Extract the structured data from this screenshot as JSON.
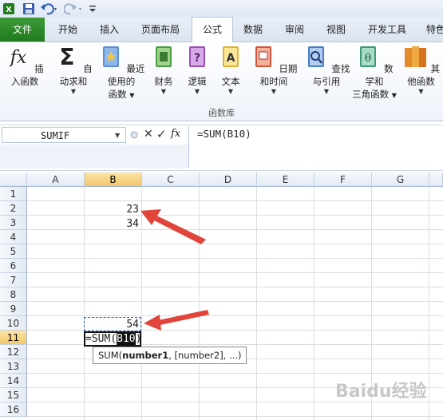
{
  "quick_access": {
    "icons": [
      "excel-icon",
      "save-icon",
      "undo-icon",
      "redo-icon",
      "customize-icon"
    ]
  },
  "tabs": {
    "file": "文件",
    "items": [
      "开始",
      "插入",
      "页面布局",
      "公式",
      "数据",
      "审阅",
      "视图",
      "开发工具",
      "特色"
    ],
    "active": "公式"
  },
  "ribbon": {
    "buttons": [
      {
        "label": "插入函数",
        "label2": "",
        "dropdown": false,
        "icon": "fx-icon"
      },
      {
        "label": "自动求和",
        "label2": "",
        "dropdown": true,
        "icon": "sigma-icon"
      },
      {
        "label": "最近使用的",
        "label2": "函数",
        "dropdown": true,
        "icon": "star-book-icon"
      },
      {
        "label": "财务",
        "label2": "",
        "dropdown": true,
        "icon": "finance-book-icon"
      },
      {
        "label": "逻辑",
        "label2": "",
        "dropdown": true,
        "icon": "logic-book-icon"
      },
      {
        "label": "文本",
        "label2": "",
        "dropdown": true,
        "icon": "text-book-icon"
      },
      {
        "label": "日期和时间",
        "label2": "",
        "dropdown": true,
        "icon": "datetime-book-icon"
      },
      {
        "label": "查找与引用",
        "label2": "",
        "dropdown": true,
        "icon": "lookup-book-icon"
      },
      {
        "label": "数学和",
        "label2": "三角函数",
        "dropdown": true,
        "icon": "math-book-icon"
      },
      {
        "label": "其他函数",
        "label2": "",
        "dropdown": true,
        "icon": "more-books-icon"
      }
    ],
    "group_label": "函数库"
  },
  "formula_bar": {
    "name_box": "SUMIF",
    "formula": "=SUM(B10)",
    "cancel": "✕",
    "enter": "✓",
    "fx": "fx"
  },
  "sheet": {
    "columns": [
      "A",
      "B",
      "C",
      "D",
      "E",
      "F",
      "G"
    ],
    "rows": [
      "1",
      "2",
      "3",
      "4",
      "5",
      "6",
      "7",
      "8",
      "9",
      "10",
      "11",
      "12",
      "13",
      "14",
      "15",
      "16"
    ],
    "active_column": "B",
    "active_row": "11",
    "cells": {
      "B2": "23",
      "B3": "34",
      "B10": "54"
    },
    "editing_prefix": "=SUM(",
    "editing_ref": "B10",
    "editing_suffix": ")",
    "tooltip_func": "SUM(",
    "tooltip_bold": "number1",
    "tooltip_rest": ", [number2], ...)"
  },
  "watermark": "Baidu经验",
  "colors": {
    "file_tab": "#1f7a1c",
    "arrow": "#e0443a",
    "selection": "#2d5fb4"
  }
}
